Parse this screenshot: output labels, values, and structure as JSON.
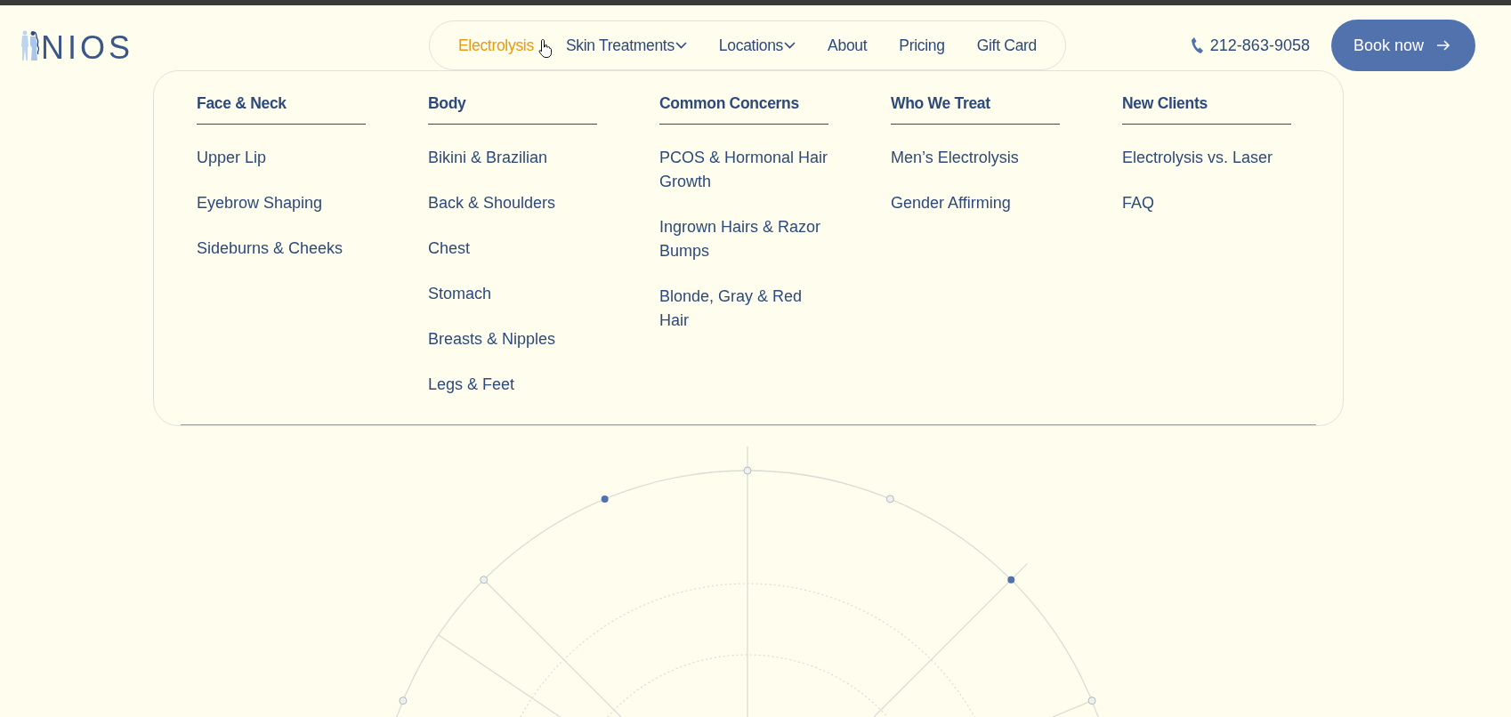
{
  "logo": {
    "text": "NIOS"
  },
  "nav": [
    {
      "label": "Electrolysis",
      "selected": true,
      "has_menu": false
    },
    {
      "label": "Skin Treatments",
      "selected": false,
      "has_menu": true
    },
    {
      "label": "Locations",
      "selected": false,
      "has_menu": true
    },
    {
      "label": "About",
      "selected": false,
      "has_menu": false
    },
    {
      "label": "Pricing",
      "selected": false,
      "has_menu": false
    },
    {
      "label": "Gift Card",
      "selected": false,
      "has_menu": false
    }
  ],
  "phone": "212-863-9058",
  "book_button": {
    "label": "Book now"
  },
  "mega_menu": {
    "columns": [
      {
        "heading": "Face & Neck",
        "items": [
          "Upper Lip",
          "Eyebrow Shaping",
          "Sideburns & Cheeks"
        ]
      },
      {
        "heading": "Body",
        "items": [
          "Bikini & Brazilian",
          "Back & Shoulders",
          "Chest",
          "Stomach",
          "Breasts & Nipples",
          "Legs & Feet"
        ]
      },
      {
        "heading": "Common Concerns",
        "items": [
          "PCOS & Hormonal Hair Growth",
          "Ingrown Hairs & Razor Bumps",
          "Blonde, Gray & Red Hair"
        ]
      },
      {
        "heading": "Who We Treat",
        "items": [
          "Men’s Electrolysis",
          "Gender Affirming"
        ]
      },
      {
        "heading": "New Clients",
        "items": [
          "Electrolysis vs. Laser",
          "FAQ"
        ]
      }
    ]
  }
}
